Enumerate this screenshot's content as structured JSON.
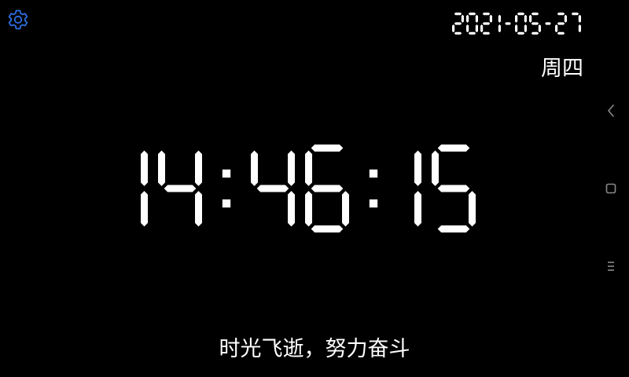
{
  "settings": {
    "icon": "gear-icon",
    "color": "#2d6fe0"
  },
  "header": {
    "date": "2021-05-27",
    "weekday": "周四"
  },
  "clock": {
    "time": "14:46:15",
    "color": "#ffffff"
  },
  "motto": "时光飞逝，努力奋斗",
  "nav": {
    "back_icon": "chevron-left-icon",
    "home_icon": "square-icon",
    "menu_icon": "menu-lines-icon",
    "color": "#8a8a8a"
  }
}
